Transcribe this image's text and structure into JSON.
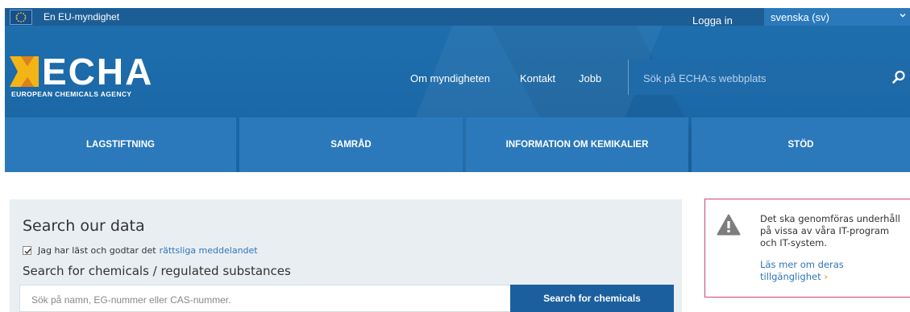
{
  "topbar": {
    "eu_label": "En EU-myndighet",
    "login": "Logga in",
    "language": "svenska (sv)"
  },
  "logo": {
    "name": "ECHA",
    "subtitle": "EUROPEAN CHEMICALS AGENCY"
  },
  "header_nav": [
    "Om myndigheten",
    "Kontakt",
    "Jobb"
  ],
  "site_search": {
    "placeholder": "Sök på ECHA:s webbplats"
  },
  "main_nav": [
    "LAGSTIFTNING",
    "SAMRÅD",
    "INFORMATION OM KEMIKALIER",
    "STÖD"
  ],
  "search_panel": {
    "title": "Search our data",
    "checkbox_text": "Jag har läst och godtar det",
    "checkbox_link": "rättsliga meddelandet",
    "checked": true,
    "subtitle": "Search for chemicals / regulated substances",
    "input_placeholder": "Sök på namn, EG-nummer eller CAS-nummer.",
    "button": "Search for chemicals"
  },
  "notice": {
    "text": "Det ska genomföras underhåll på vissa av våra IT-program och IT-system.",
    "link": "Läs mer om deras tillgänglighet",
    "chevron": "›"
  },
  "colors": {
    "header_blue": "#1e6fae",
    "nav_blue": "#2b79bb",
    "button_blue": "#1c5f9e",
    "panel_bg": "#e9eef3",
    "link_blue": "#2d76b9",
    "notice_border": "#c94b6d",
    "accent_orange": "#f0a030"
  }
}
